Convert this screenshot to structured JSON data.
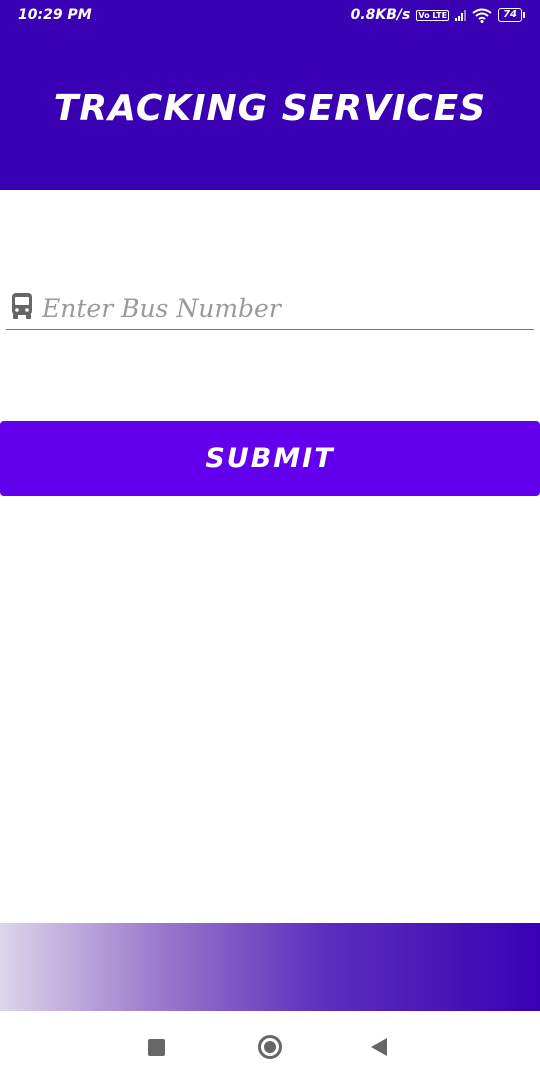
{
  "status_bar": {
    "time": "10:29 PM",
    "net_speed": "0.8KB/s",
    "volte": "Vo LTE",
    "battery": "74"
  },
  "header": {
    "title": "TRACKING SERVICES"
  },
  "form": {
    "icon": "bus-icon",
    "bus_number_placeholder": "Enter Bus Number",
    "bus_number_value": "",
    "submit_label": "SUBMIT"
  },
  "navigation": {
    "icons": [
      "recents-icon",
      "home-icon",
      "back-icon"
    ]
  },
  "colors": {
    "primary_dark": "#3a00b4",
    "primary": "#6200ee",
    "icon_gray": "#666666",
    "placeholder_gray": "#9a9a9a"
  }
}
